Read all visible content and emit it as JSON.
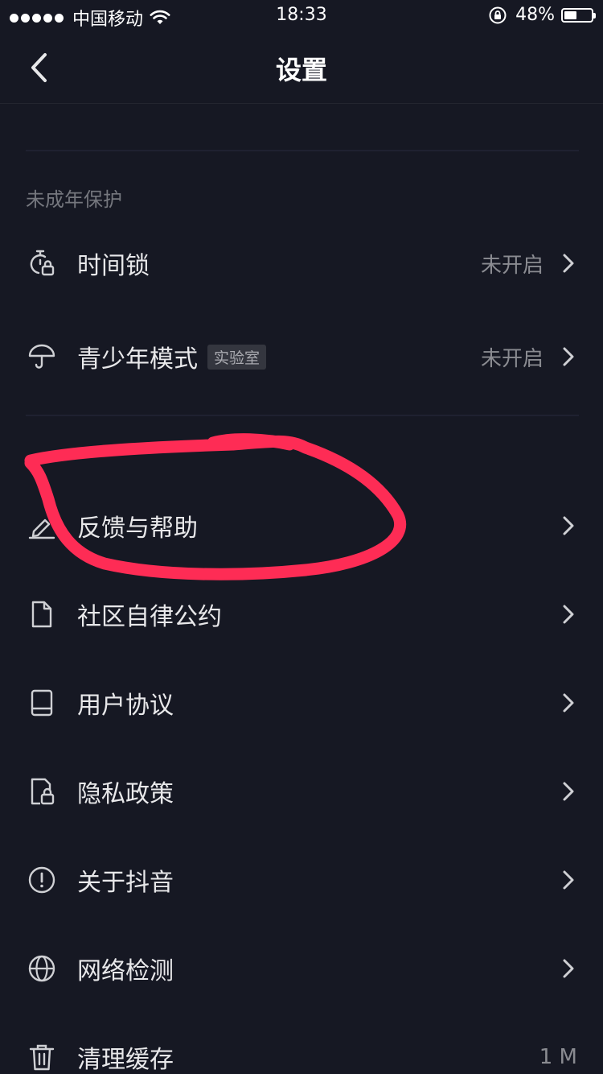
{
  "status_bar": {
    "carrier": "中国移动",
    "time": "18:33",
    "battery_percent": "48%",
    "battery_level": 0.48,
    "icons": [
      "signal-dots-icon",
      "wifi-icon",
      "rotation-lock-icon",
      "battery-icon"
    ]
  },
  "nav": {
    "title": "设置",
    "back_icon": "chevron-left-icon"
  },
  "sections": {
    "minor_protection": {
      "header": "未成年保护",
      "items": [
        {
          "label": "时间锁",
          "value": "未开启",
          "icon": "timer-lock-icon"
        },
        {
          "label": "青少年模式",
          "tag": "实验室",
          "value": "未开启",
          "icon": "umbrella-icon"
        }
      ]
    },
    "about": {
      "items": [
        {
          "label": "反馈与帮助",
          "icon": "edit-pencil-icon"
        },
        {
          "label": "社区自律公约",
          "icon": "document-icon"
        },
        {
          "label": "用户协议",
          "icon": "book-icon"
        },
        {
          "label": "隐私政策",
          "icon": "privacy-lock-icon"
        },
        {
          "label": "关于抖音",
          "icon": "info-circle-icon"
        },
        {
          "label": "网络检测",
          "icon": "globe-icon"
        },
        {
          "label": "清理缓存",
          "value": "1 M",
          "icon": "trash-icon"
        }
      ]
    }
  },
  "colors": {
    "background": "#161823",
    "annotation_stroke": "#fe2c55",
    "text_primary": "#e8e8ea",
    "text_secondary": "#8a8b91"
  }
}
